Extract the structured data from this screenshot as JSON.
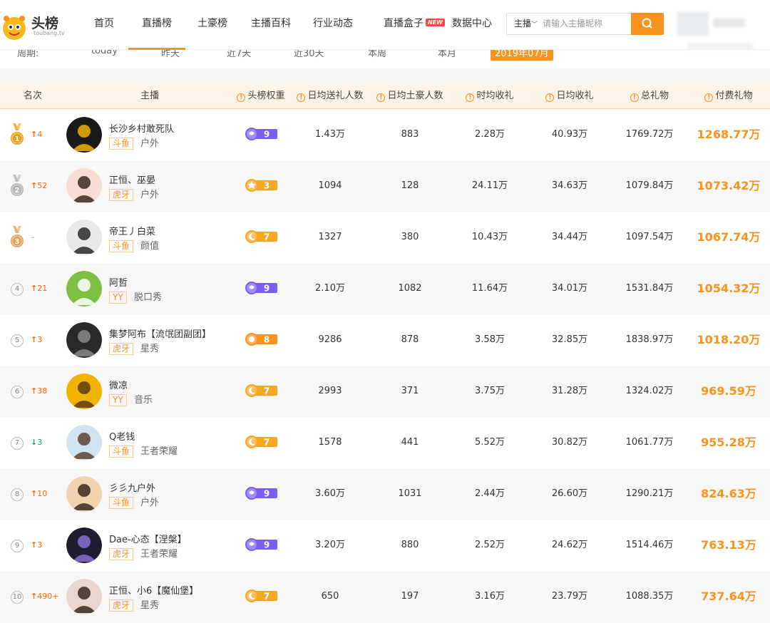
{
  "header": {
    "brand": "头榜",
    "brand_sub": "toubang.tv",
    "nav": [
      {
        "label": "首页",
        "active": false
      },
      {
        "label": "直播榜",
        "active": true
      },
      {
        "label": "土豪榜",
        "active": false
      },
      {
        "label": "主播百科",
        "active": false
      },
      {
        "label": "行业动态",
        "active": false
      },
      {
        "label": "直播盒子",
        "active": false,
        "badge": "NEW"
      },
      {
        "label": "数据中心",
        "active": false
      }
    ],
    "search": {
      "select": "主播",
      "placeholder": "请输入主播昵称"
    }
  },
  "period": {
    "label": "周期:",
    "options": [
      "today",
      "昨天",
      "近7天",
      "近30天",
      "本周",
      "本月",
      "2019年07月"
    ],
    "active_index": 6
  },
  "table": {
    "headers": [
      "名次",
      "主播",
      "头榜权重",
      "日均送礼人数",
      "日均土豪人数",
      "时均收礼",
      "日均收礼",
      "总礼物",
      "付费礼物"
    ],
    "rows": [
      {
        "rank": "1",
        "trend": "4",
        "trend_dir": "up",
        "name": "长沙乡村敢死队",
        "platform": "斗鱼",
        "category": "户外",
        "weight": "9",
        "weight_icon": "purple",
        "senders": "1.43万",
        "tycoons": "883",
        "hourly": "2.28万",
        "daily": "40.93万",
        "total": "1769.72万",
        "paid": "1268.77万"
      },
      {
        "rank": "2",
        "trend": "52",
        "trend_dir": "up",
        "name": "正恒、巫晏",
        "platform": "虎牙",
        "category": "户外",
        "weight": "3",
        "weight_icon": "star",
        "senders": "1094",
        "tycoons": "128",
        "hourly": "24.11万",
        "daily": "34.63万",
        "total": "1079.84万",
        "paid": "1073.42万"
      },
      {
        "rank": "3",
        "trend": "–",
        "trend_dir": "flat",
        "name": "帝王丿白菜",
        "platform": "斗鱼",
        "category": "颜值",
        "weight": "7",
        "weight_icon": "moon",
        "senders": "1327",
        "tycoons": "380",
        "hourly": "10.43万",
        "daily": "34.44万",
        "total": "1097.54万",
        "paid": "1067.74万"
      },
      {
        "rank": "4",
        "trend": "21",
        "trend_dir": "up",
        "name": "阿哲",
        "platform": "YY",
        "category": "脱口秀",
        "weight": "9",
        "weight_icon": "purple",
        "senders": "2.10万",
        "tycoons": "1082",
        "hourly": "11.64万",
        "daily": "34.01万",
        "total": "1531.84万",
        "paid": "1054.32万"
      },
      {
        "rank": "5",
        "trend": "3",
        "trend_dir": "up",
        "name": "集梦阿布【流氓团副团】",
        "platform": "虎牙",
        "category": "星秀",
        "weight": "8",
        "weight_icon": "sun",
        "senders": "9286",
        "tycoons": "878",
        "hourly": "3.58万",
        "daily": "32.85万",
        "total": "1838.97万",
        "paid": "1018.20万"
      },
      {
        "rank": "6",
        "trend": "38",
        "trend_dir": "up",
        "name": "微凉",
        "platform": "YY",
        "category": "音乐",
        "weight": "7",
        "weight_icon": "moon",
        "senders": "2993",
        "tycoons": "371",
        "hourly": "3.75万",
        "daily": "31.28万",
        "total": "1324.02万",
        "paid": "969.59万"
      },
      {
        "rank": "7",
        "trend": "3",
        "trend_dir": "down",
        "name": "Q老钱",
        "platform": "斗鱼",
        "category": "王者荣耀",
        "weight": "7",
        "weight_icon": "moon",
        "senders": "1578",
        "tycoons": "441",
        "hourly": "5.52万",
        "daily": "30.82万",
        "total": "1061.77万",
        "paid": "955.28万"
      },
      {
        "rank": "8",
        "trend": "10",
        "trend_dir": "up",
        "name": "彡彡九户外",
        "platform": "斗鱼",
        "category": "户外",
        "weight": "9",
        "weight_icon": "purple",
        "senders": "3.60万",
        "tycoons": "1031",
        "hourly": "2.44万",
        "daily": "26.60万",
        "total": "1290.21万",
        "paid": "824.63万"
      },
      {
        "rank": "9",
        "trend": "3",
        "trend_dir": "up",
        "name": "Dae-心态【涅槃】",
        "platform": "虎牙",
        "category": "王者荣耀",
        "weight": "9",
        "weight_icon": "purple",
        "senders": "3.20万",
        "tycoons": "880",
        "hourly": "2.52万",
        "daily": "24.62万",
        "total": "1514.46万",
        "paid": "763.13万"
      },
      {
        "rank": "10",
        "trend": "490+",
        "trend_dir": "up",
        "name": "正恒、小6【魔仙堡】",
        "platform": "虎牙",
        "category": "星秀",
        "weight": "7",
        "weight_icon": "moon",
        "senders": "650",
        "tycoons": "197",
        "hourly": "3.16万",
        "daily": "23.79万",
        "total": "1088.35万",
        "paid": "737.64万"
      }
    ]
  },
  "colors": {
    "accent": "#f7931e",
    "up": "#ff6600",
    "down": "#2a9d5c",
    "gold": "#e8a21a",
    "silver": "#b5b5b5",
    "bronze": "#e0a45c"
  }
}
